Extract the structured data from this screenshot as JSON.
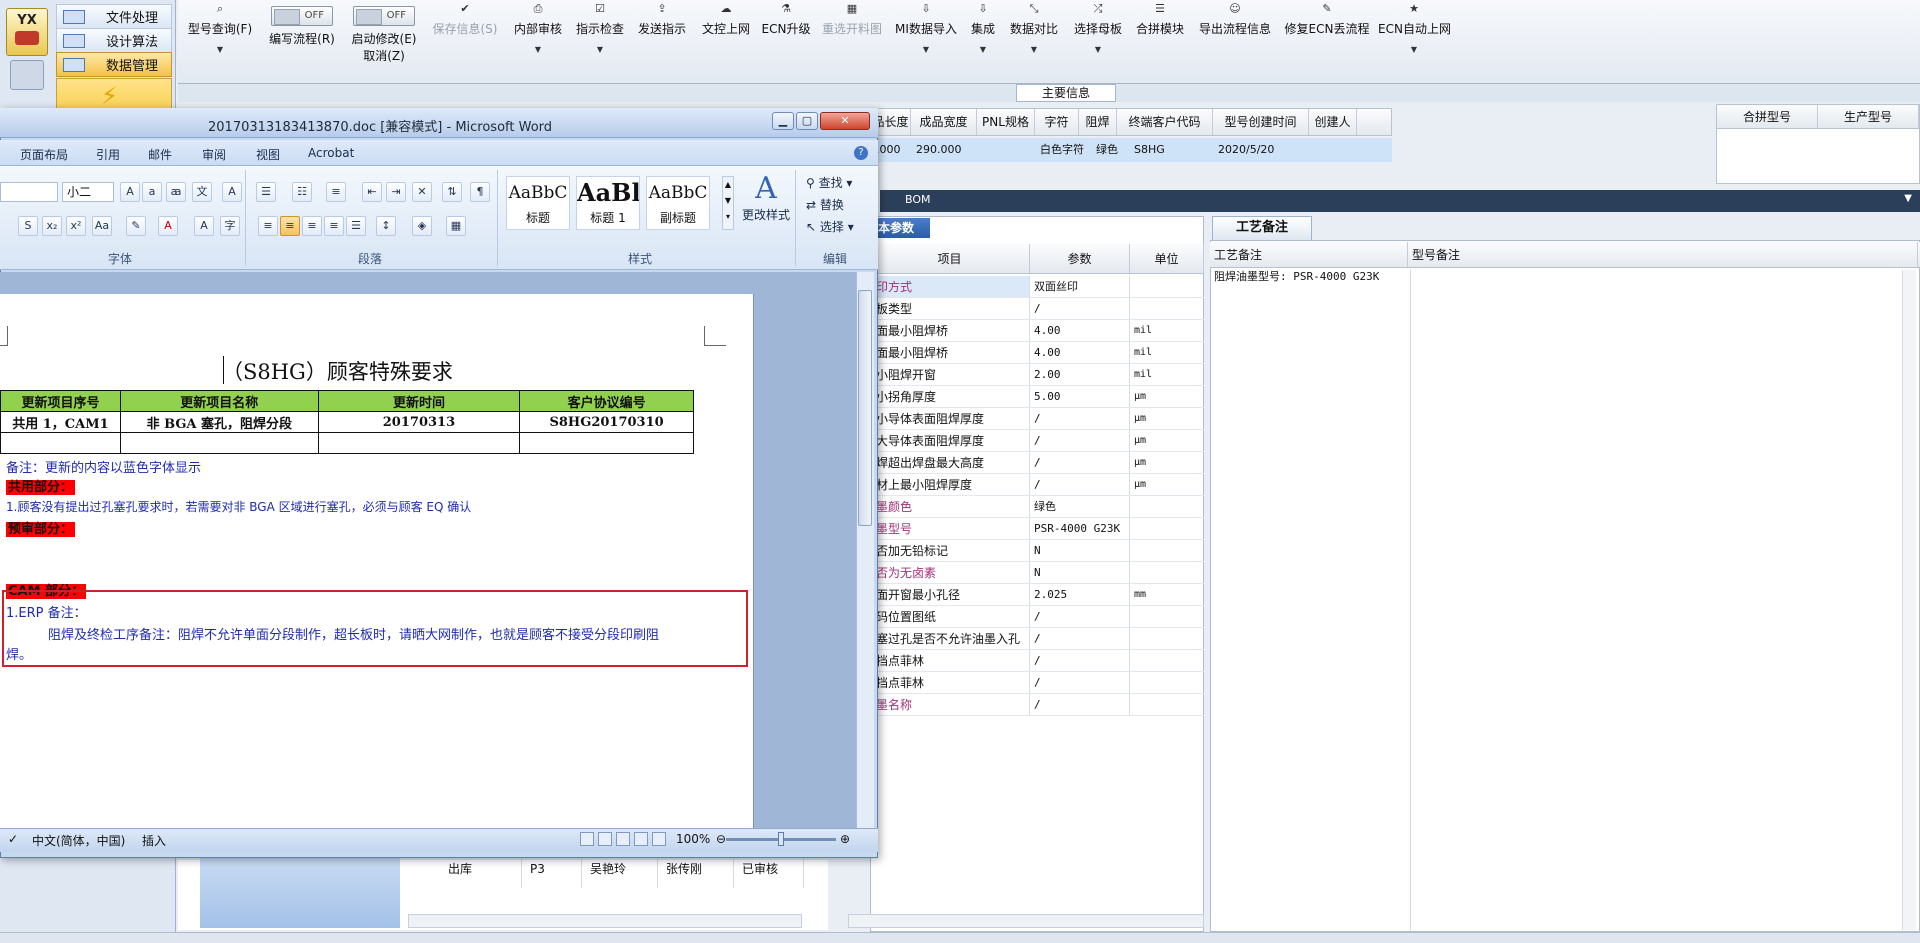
{
  "app": {
    "logo_text": "YX",
    "nav": [
      "文件处理",
      "设计算法",
      "数据管理"
    ],
    "toolbar": [
      {
        "label": "型号查询(F)",
        "icon": "search-icon",
        "enabled": true
      },
      {
        "label": "保存信息(S)",
        "icon": "check-icon",
        "enabled": false
      },
      {
        "label": "内部审核",
        "icon": "print-icon",
        "enabled": true
      },
      {
        "label": "指示检查",
        "icon": "checkbox-icon",
        "enabled": true
      },
      {
        "label": "发送指示",
        "icon": "upload-icon",
        "enabled": true
      },
      {
        "label": "文控上网",
        "icon": "cloud-upload-icon",
        "enabled": true
      },
      {
        "label": "ECN升级",
        "icon": "flask-icon",
        "enabled": true
      },
      {
        "label": "重选开料图",
        "icon": "image-icon",
        "enabled": false
      },
      {
        "label": "MI数据导入",
        "icon": "download-icon",
        "enabled": true
      },
      {
        "label": "集成",
        "icon": "download-icon",
        "enabled": true
      },
      {
        "label": "数据对比",
        "icon": "compress-icon",
        "enabled": true
      },
      {
        "label": "选择母板",
        "icon": "shuffle-icon",
        "enabled": true
      },
      {
        "label": "合拼模块",
        "icon": "list-icon",
        "enabled": true
      },
      {
        "label": "导出流程信息",
        "icon": "smile-icon",
        "enabled": true
      },
      {
        "label": "修复ECN丢流程",
        "icon": "wrench-icon",
        "enabled": true
      },
      {
        "label": "ECN自动上网",
        "icon": "star-icon",
        "enabled": true
      }
    ],
    "toggles": [
      {
        "label": "编写流程(R)",
        "state": "OFF"
      },
      {
        "label": "启动修改(E)",
        "state": "OFF",
        "sub": "取消(Z)"
      }
    ],
    "main_info_title": "主要信息",
    "grid": {
      "headers": [
        "品长度",
        "成品宽度",
        "PNL规格",
        "字符",
        "阻焊",
        "终端客户代码",
        "型号创建时间",
        "创建人"
      ],
      "row": [
        ".000",
        "290.000",
        "",
        "白色字符",
        "绿色",
        "S8HG",
        "2020/5/20",
        ""
      ]
    },
    "combine": {
      "headers": [
        "合拼型号",
        "生产型号"
      ]
    },
    "bom_label": "BOM",
    "params": {
      "tab": "本参数",
      "headers": [
        "项目",
        "参数",
        "单位"
      ],
      "rows": [
        {
          "item": "印方式",
          "value": "双面丝印",
          "unit": "",
          "style": "hl-pink"
        },
        {
          "item": "板类型",
          "value": "/",
          "unit": "",
          "style": ""
        },
        {
          "item": "面最小阻焊桥",
          "value": "4.00",
          "unit": "mil",
          "style": ""
        },
        {
          "item": "面最小阻焊桥",
          "value": "4.00",
          "unit": "mil",
          "style": ""
        },
        {
          "item": "小阻焊开窗",
          "value": "2.00",
          "unit": "mil",
          "style": ""
        },
        {
          "item": "小拐角厚度",
          "value": "5.00",
          "unit": "μm",
          "style": ""
        },
        {
          "item": "小导体表面阻焊厚度",
          "value": "/",
          "unit": "μm",
          "style": ""
        },
        {
          "item": "大导体表面阻焊厚度",
          "value": "/",
          "unit": "μm",
          "style": ""
        },
        {
          "item": "焊超出焊盘最大高度",
          "value": "/",
          "unit": "μm",
          "style": ""
        },
        {
          "item": "材上最小阻焊厚度",
          "value": "/",
          "unit": "μm",
          "style": ""
        },
        {
          "item": "墨颜色",
          "value": "绿色",
          "unit": "",
          "style": "pink"
        },
        {
          "item": "墨型号",
          "value": "PSR-4000 G23K",
          "unit": "",
          "style": "pink"
        },
        {
          "item": "否加无铅标记",
          "value": "N",
          "unit": "",
          "style": ""
        },
        {
          "item": "否为无卤素",
          "value": "N",
          "unit": "",
          "style": "pink"
        },
        {
          "item": "面开窗最小孔径",
          "value": "2.025",
          "unit": "mm",
          "style": ""
        },
        {
          "item": "码位置图纸",
          "value": "/",
          "unit": "",
          "style": ""
        },
        {
          "item": "塞过孔是否不允许油墨入孔",
          "value": "/",
          "unit": "",
          "style": ""
        },
        {
          "item": "挡点菲林",
          "value": "/",
          "unit": "",
          "style": ""
        },
        {
          "item": "挡点菲林",
          "value": "/",
          "unit": "",
          "style": ""
        },
        {
          "item": "墨名称",
          "value": "/",
          "unit": "",
          "style": "pink"
        }
      ]
    },
    "notes": {
      "tab": "工艺备注",
      "headers": [
        "工艺备注",
        "型号备注"
      ],
      "value": "阻焊油墨型号: PSR-4000 G23K"
    },
    "bottom": {
      "tree": [
        "出库",
        "P3",
        "吴艳玲",
        "张传刚",
        "已审核"
      ]
    }
  },
  "word": {
    "title": "20170313183413870.doc [兼容模式] - Microsoft Word",
    "tabs": [
      "页面布局",
      "引用",
      "邮件",
      "审阅",
      "视图",
      "Acrobat"
    ],
    "font_size": "小二",
    "groups": {
      "font": "字体",
      "paragraph": "段落",
      "styles": "样式",
      "edit": "编辑"
    },
    "styles": [
      {
        "sample": "AaBbC",
        "name": "标题"
      },
      {
        "sample": "AaBl",
        "name": "标题 1"
      },
      {
        "sample": "AaBbC",
        "name": "副标题"
      }
    ],
    "change_styles": "更改样式",
    "edit_actions": [
      "查找 ▾",
      "替换",
      "选择 ▾"
    ],
    "doc": {
      "heading": "（S8HG）顾客特殊要求",
      "table_header": [
        "更新项目序号",
        "更新项目名称",
        "更新时间",
        "客户协议编号"
      ],
      "table_row": [
        "共用 1，CAM1",
        "非 BGA 塞孔，阻焊分段",
        "20170313",
        "S8HG20170310"
      ],
      "note": "备注：更新的内容以蓝色字体显示",
      "sec_common": "共用部分：",
      "line1": "1.顾客没有提出过孔塞孔要求时，若需要对非 BGA 区域进行塞孔，必须与顾客 EQ 确认",
      "sec_precheck": "预审部分：",
      "sec_cam": "CAM 部分：",
      "erp_label": "1.ERP 备注：",
      "erp_line_a": "阻焊及终检工序备注：阻焊不允许单面分段制作，超长板时，请晒大网制作，也就是顾客不接受分段印刷阻",
      "erp_line_b": "焊。"
    },
    "status": {
      "lang": "中文(简体，中国)",
      "mode": "插入",
      "zoom": "100%"
    }
  }
}
